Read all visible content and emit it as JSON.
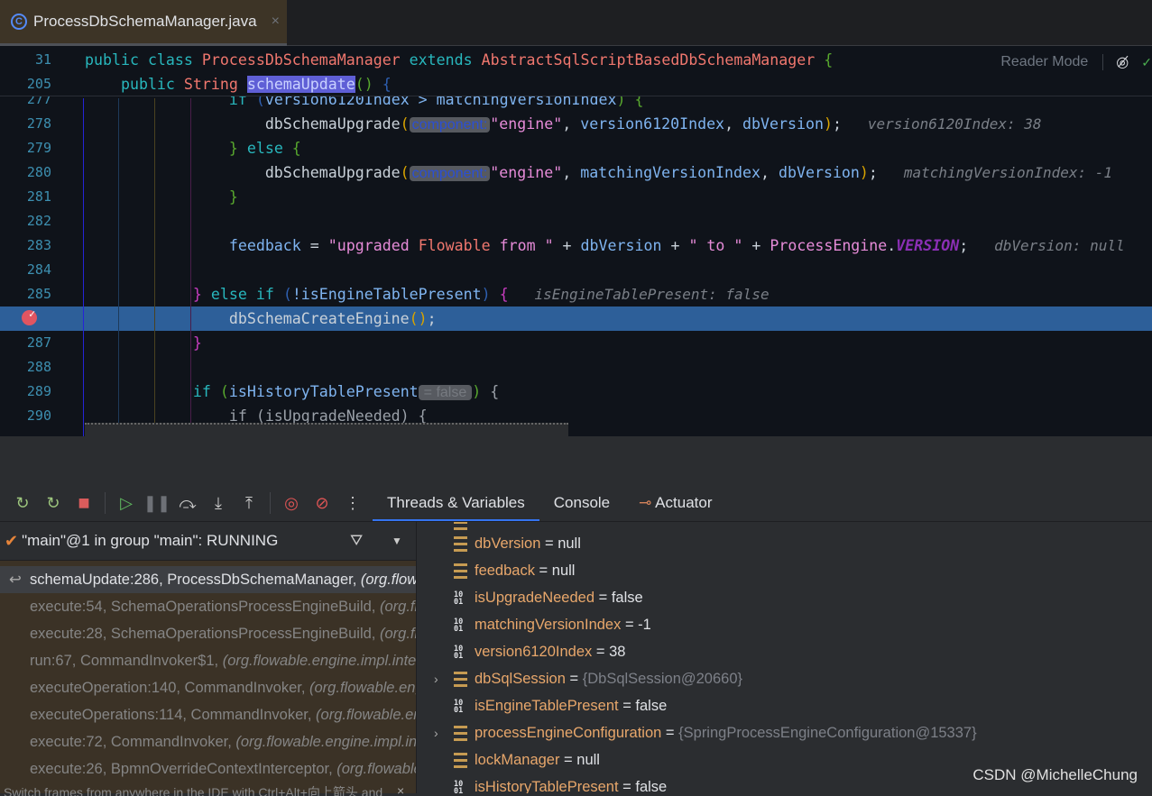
{
  "tab": {
    "filename": "ProcessDbSchemaManager.java",
    "icon": "class-icon",
    "close": "×"
  },
  "editor": {
    "reader_mode": "Reader Mode",
    "sticky": [
      {
        "num": "31",
        "indent": 0,
        "tokens": [
          [
            "public ",
            "kw"
          ],
          [
            "class ",
            "kw"
          ],
          [
            "ProcessDbSchemaManager ",
            "cls"
          ],
          [
            "extends ",
            "kw"
          ],
          [
            "AbstractSqlScriptBasedDbSchemaManager ",
            "cls"
          ],
          [
            "{",
            "grn"
          ]
        ]
      },
      {
        "num": "205",
        "indent": 4,
        "tokens": [
          [
            "public ",
            "kw"
          ],
          [
            "String ",
            "cls"
          ],
          [
            "schemaUpdate",
            "sel"
          ],
          [
            "()",
            "grn"
          ],
          [
            " {",
            "blu"
          ]
        ]
      }
    ],
    "lines": [
      {
        "num": "277",
        "indent": 16,
        "tokens": [
          [
            "if ",
            "kw"
          ],
          [
            "(",
            "blu"
          ],
          [
            "version6120Index > matchingVersionIndex",
            "id"
          ],
          [
            ") {",
            "grn"
          ]
        ]
      },
      {
        "num": "278",
        "indent": 20,
        "tokens": [
          [
            "dbSchemaUpgrade",
            "pl"
          ],
          [
            "(",
            "par"
          ],
          [
            "component:",
            "chip"
          ],
          [
            "\"engine\"",
            "str"
          ],
          [
            ", ",
            "pl"
          ],
          [
            "version6120Index",
            "id"
          ],
          [
            ", ",
            "pl"
          ],
          [
            "dbVersion",
            "id"
          ],
          [
            ")",
            "par"
          ],
          [
            ";",
            "pl"
          ],
          [
            "   version6120Index: 38",
            "hint"
          ]
        ]
      },
      {
        "num": "279",
        "indent": 16,
        "tokens": [
          [
            "} ",
            "grn"
          ],
          [
            "else ",
            "kw"
          ],
          [
            "{",
            "grn"
          ]
        ]
      },
      {
        "num": "280",
        "indent": 20,
        "tokens": [
          [
            "dbSchemaUpgrade",
            "pl"
          ],
          [
            "(",
            "par"
          ],
          [
            "component:",
            "chip"
          ],
          [
            "\"engine\"",
            "str"
          ],
          [
            ", ",
            "pl"
          ],
          [
            "matchingVersionIndex",
            "id"
          ],
          [
            ", ",
            "pl"
          ],
          [
            "dbVersion",
            "id"
          ],
          [
            ")",
            "par"
          ],
          [
            ";",
            "pl"
          ],
          [
            "   matchingVersionIndex: -1",
            "hint"
          ]
        ]
      },
      {
        "num": "281",
        "indent": 16,
        "tokens": [
          [
            "}",
            "grn"
          ]
        ]
      },
      {
        "num": "282",
        "indent": 0,
        "tokens": []
      },
      {
        "num": "283",
        "indent": 16,
        "tokens": [
          [
            "feedback",
            "id"
          ],
          [
            " = ",
            "pl"
          ],
          [
            "\"upgraded ",
            "str"
          ],
          [
            "Flowable ",
            "cls"
          ],
          [
            "from ",
            "str"
          ],
          [
            "\"",
            "str"
          ],
          [
            " + ",
            "pl"
          ],
          [
            "dbVersion",
            "id"
          ],
          [
            " + ",
            "pl"
          ],
          [
            "\" to \"",
            "str"
          ],
          [
            " + ",
            "pl"
          ],
          [
            "ProcessEngine",
            "str"
          ],
          [
            ".",
            "pl"
          ],
          [
            "VERSION",
            "vio"
          ],
          [
            ";",
            "pl"
          ],
          [
            "   dbVersion: null",
            "hint"
          ]
        ]
      },
      {
        "num": "284",
        "indent": 0,
        "tokens": []
      },
      {
        "num": "285",
        "indent": 12,
        "tokens": [
          [
            "} ",
            "brc"
          ],
          [
            "else if ",
            "kw"
          ],
          [
            "(",
            "blu"
          ],
          [
            "!isEngineTablePresent",
            "id"
          ],
          [
            ") ",
            "blu"
          ],
          [
            "{",
            "brc"
          ],
          [
            "   isEngineTablePresent: false",
            "hint"
          ]
        ]
      },
      {
        "num": "",
        "indent": 16,
        "highlight": true,
        "breakpoint": true,
        "tokens": [
          [
            "dbSchemaCreateEngine",
            "pl"
          ],
          [
            "()",
            "par"
          ],
          [
            ";",
            "pl"
          ]
        ]
      },
      {
        "num": "287",
        "indent": 12,
        "tokens": [
          [
            "}",
            "brc"
          ]
        ]
      },
      {
        "num": "288",
        "indent": 0,
        "tokens": []
      },
      {
        "num": "289",
        "indent": 12,
        "tokens": [
          [
            "if ",
            "kw"
          ],
          [
            "(",
            "grn"
          ],
          [
            "isHistoryTablePresent",
            "id"
          ],
          [
            "= false",
            "chip2"
          ],
          [
            ") ",
            "grn"
          ],
          [
            "{",
            "dim"
          ]
        ]
      },
      {
        "num": "290",
        "indent": 16,
        "tokens": [
          [
            "if (isUpgradeNeeded) {",
            "dim"
          ]
        ]
      }
    ]
  },
  "debugger": {
    "toolbar": [
      "rerun-icon",
      "rerun-debug-icon",
      "stop-icon",
      "resume-icon",
      "pause-icon",
      "step-over-icon",
      "step-into-icon",
      "step-out-icon",
      "view-breakpoints-icon",
      "mute-breakpoints-icon",
      "more-icon"
    ],
    "tabs": [
      {
        "label": "Threads & Variables",
        "active": true
      },
      {
        "label": "Console"
      },
      {
        "label": "Actuator",
        "icon": "actuator-icon"
      }
    ],
    "thread": "\"main\"@1 in group \"main\": RUNNING",
    "frames": [
      {
        "method": "schemaUpdate:286, ProcessDbSchemaManager",
        "pkg": "(org.flowable.engine.impl.db)",
        "current": true
      },
      {
        "method": "execute:54, SchemaOperationsProcessEngineBuild",
        "pkg": "(org.flowable.engine.impl)"
      },
      {
        "method": "execute:28, SchemaOperationsProcessEngineBuild",
        "pkg": "(org.flowable.engine.impl)"
      },
      {
        "method": "run:67, CommandInvoker$1",
        "pkg": "(org.flowable.engine.impl.interceptor)"
      },
      {
        "method": "executeOperation:140, CommandInvoker",
        "pkg": "(org.flowable.engine.impl)"
      },
      {
        "method": "executeOperations:114, CommandInvoker",
        "pkg": "(org.flowable.engine.impl)"
      },
      {
        "method": "execute:72, CommandInvoker",
        "pkg": "(org.flowable.engine.impl.interceptor)"
      },
      {
        "method": "execute:26, BpmnOverrideContextInterceptor",
        "pkg": "(org.flowable.engine.impl)"
      }
    ],
    "switch_tip": "Switch frames from anywhere in the IDE with Ctrl+Alt+向上箭头 and",
    "variables": [
      {
        "name": "dbVersion",
        "value": "null",
        "kind": "field"
      },
      {
        "name": "feedback",
        "value": "null",
        "kind": "field"
      },
      {
        "name": "isUpgradeNeeded",
        "value": "false",
        "kind": "primitive"
      },
      {
        "name": "matchingVersionIndex",
        "value": "-1",
        "kind": "primitive"
      },
      {
        "name": "version6120Index",
        "value": "38",
        "kind": "primitive"
      },
      {
        "name": "dbSqlSession",
        "value": "{DbSqlSession@20660}",
        "kind": "field",
        "expandable": true
      },
      {
        "name": "isEngineTablePresent",
        "value": "false",
        "kind": "primitive"
      },
      {
        "name": "processEngineConfiguration",
        "value": "{SpringProcessEngineConfiguration@15337}",
        "kind": "field",
        "expandable": true
      },
      {
        "name": "lockManager",
        "value": "null",
        "kind": "field"
      },
      {
        "name": "isHistoryTablePresent",
        "value": "false",
        "kind": "primitive"
      }
    ]
  },
  "watermark": "CSDN @MichelleChung"
}
